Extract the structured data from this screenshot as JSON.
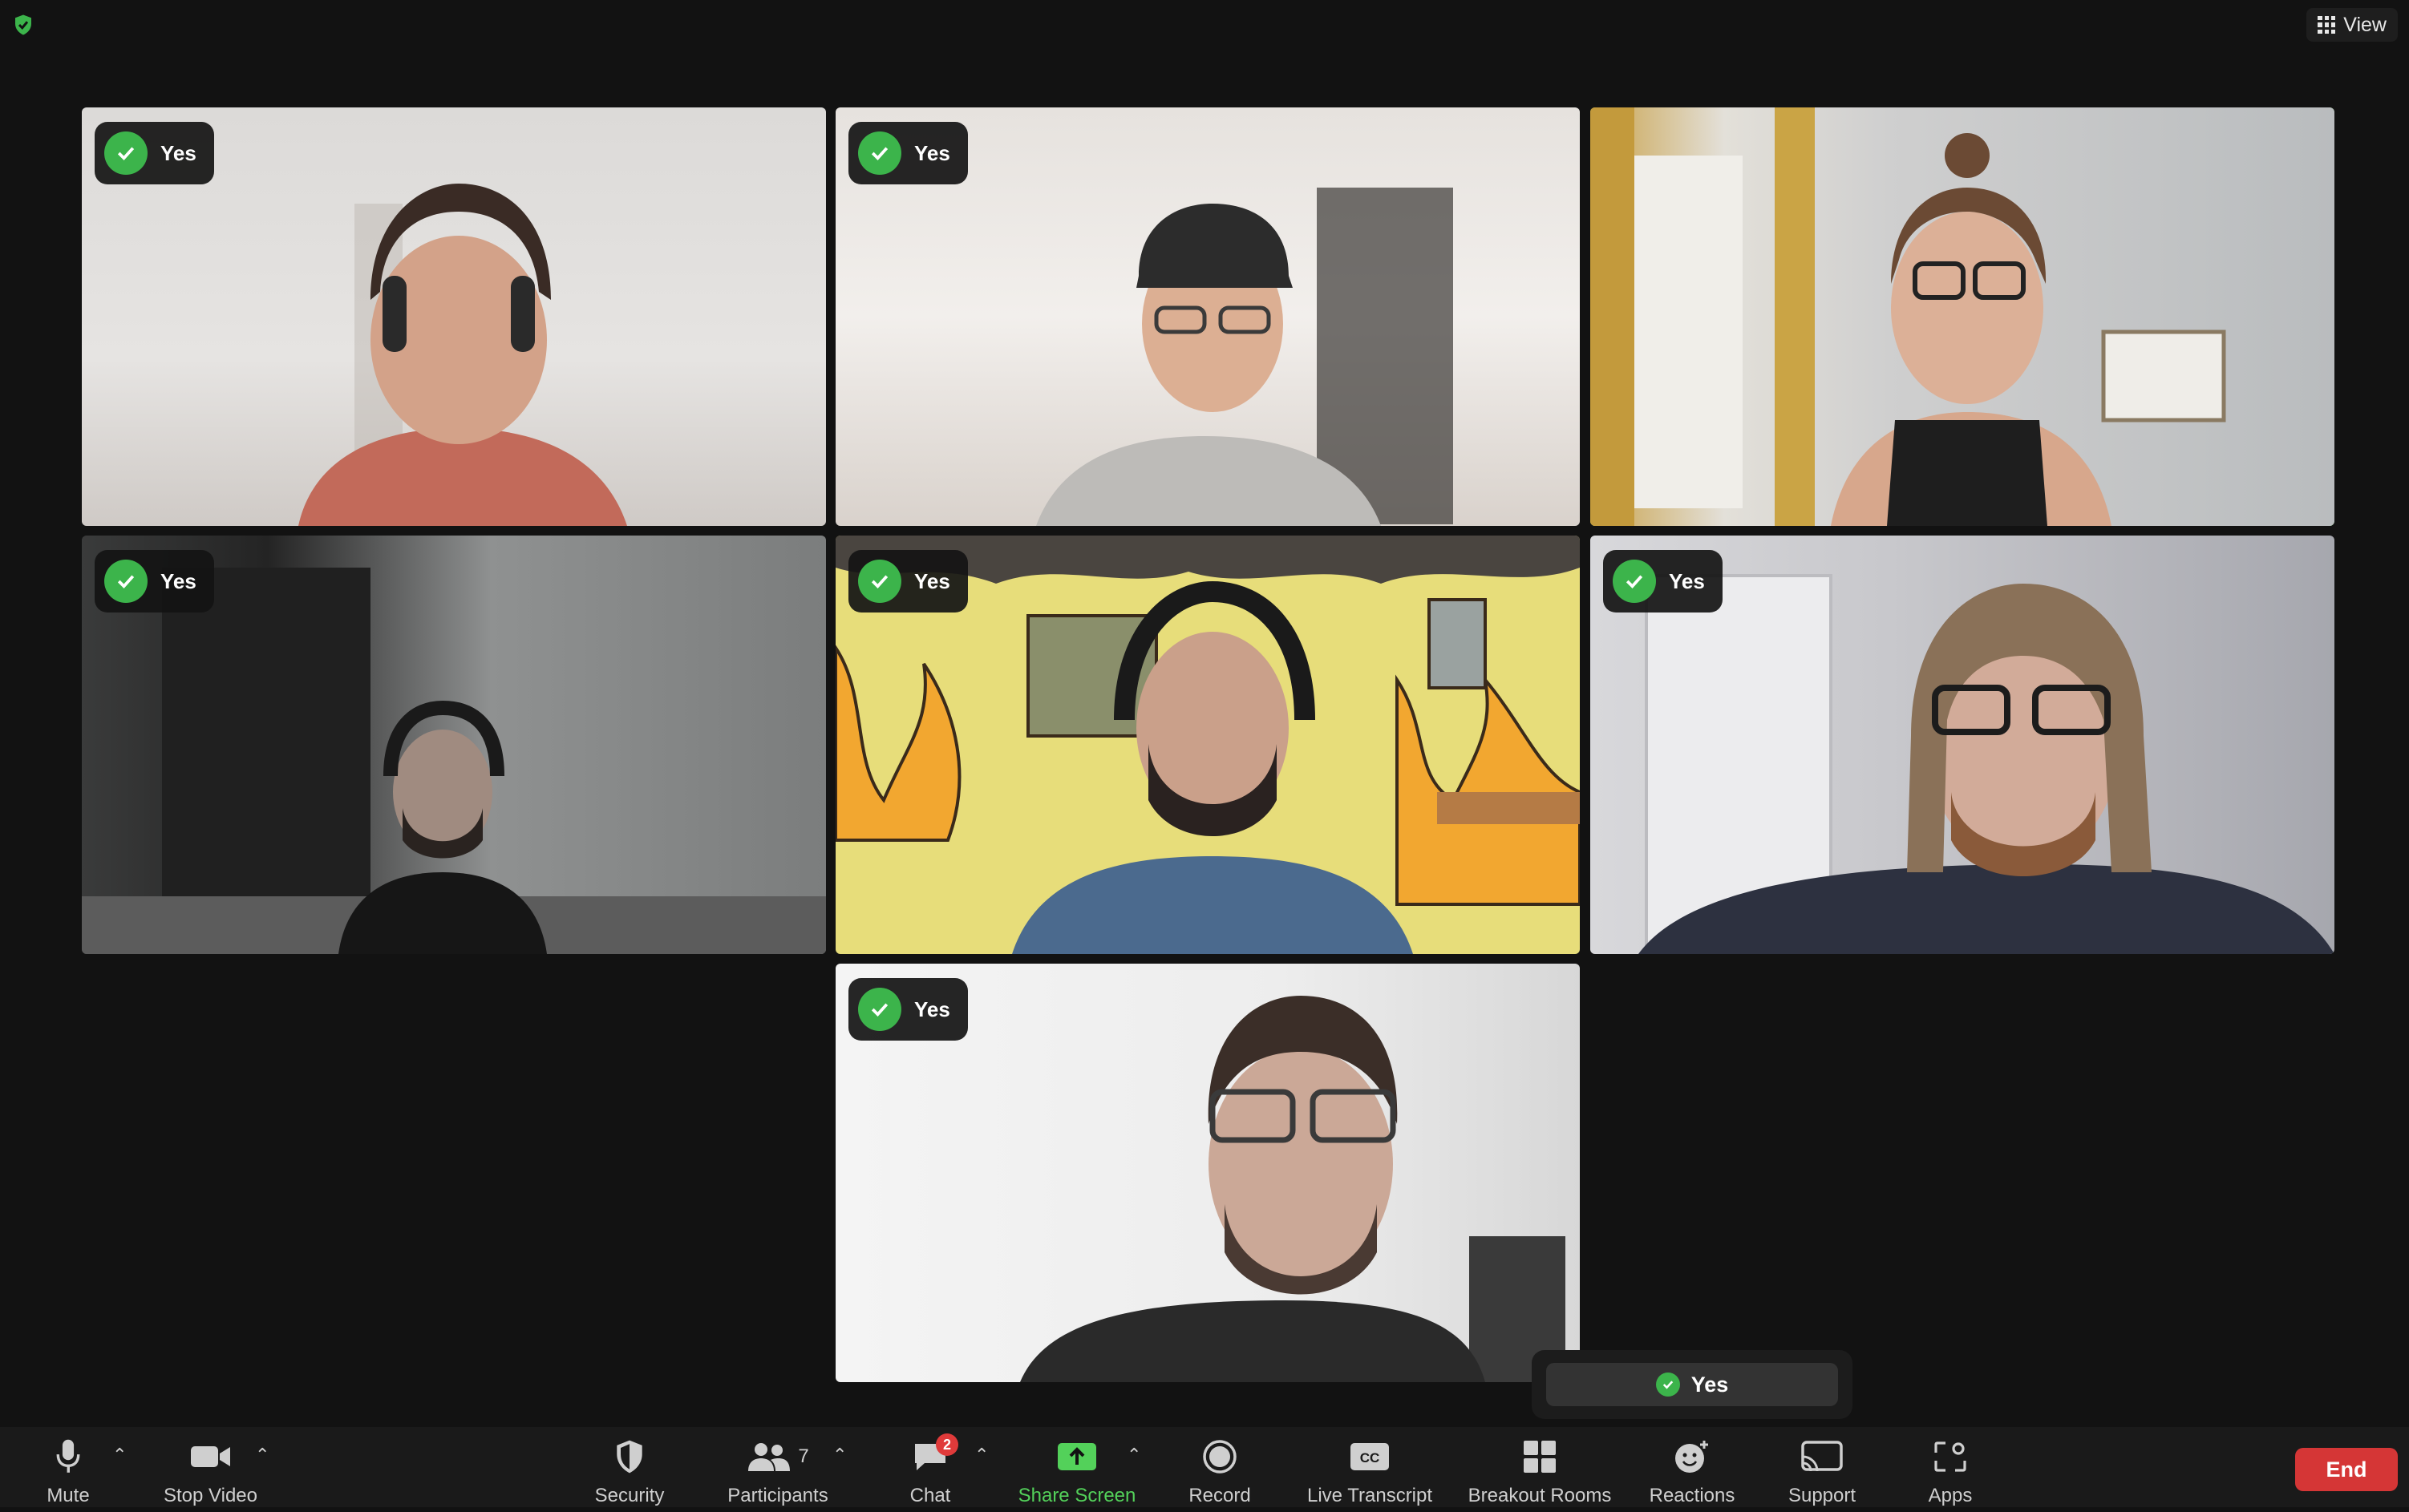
{
  "header": {
    "view_label": "View"
  },
  "participants": [
    {
      "vote": "Yes",
      "active": false
    },
    {
      "vote": "Yes",
      "active": false
    },
    {
      "vote": "",
      "active": true
    },
    {
      "vote": "Yes",
      "active": false
    },
    {
      "vote": "Yes",
      "active": false
    },
    {
      "vote": "Yes",
      "active": false
    },
    {
      "vote": "Yes",
      "active": false
    }
  ],
  "poll": {
    "my_vote": "Yes"
  },
  "toolbar": {
    "mute": "Mute",
    "stop_video": "Stop Video",
    "security": "Security",
    "participants": "Participants",
    "participants_count": "7",
    "chat": "Chat",
    "chat_unread": "2",
    "share_screen": "Share Screen",
    "record": "Record",
    "live_transcript": "Live Transcript",
    "breakout_rooms": "Breakout Rooms",
    "reactions": "Reactions",
    "support": "Support",
    "apps": "Apps",
    "end": "End"
  },
  "colors": {
    "accent_green": "#4ac94d",
    "end_red": "#d53636",
    "chat_badge": "#e03a3a"
  },
  "icons": [
    "shield-check-icon",
    "grid-icon",
    "check-icon",
    "microphone-icon",
    "video-camera-icon",
    "shield-icon",
    "people-icon",
    "chat-bubble-icon",
    "share-screen-icon",
    "record-icon",
    "cc-icon",
    "breakout-rooms-icon",
    "reactions-icon",
    "support-icon",
    "apps-icon",
    "caret-up-icon"
  ]
}
